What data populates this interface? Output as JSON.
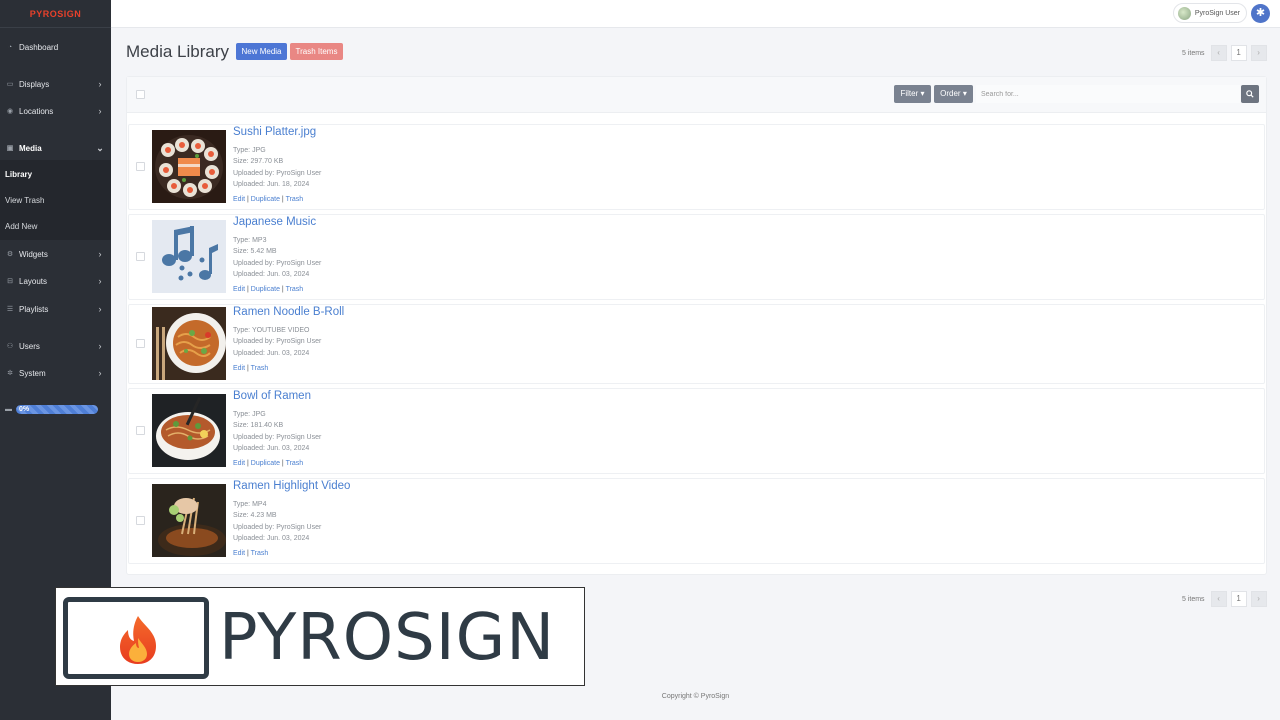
{
  "brand": "PYROSIGN",
  "sidebar": {
    "items": [
      {
        "label": "Dashboard",
        "icon": "dashboard-icon"
      },
      {
        "label": "Displays",
        "icon": "monitor-icon"
      },
      {
        "label": "Locations",
        "icon": "map-pin-icon"
      },
      {
        "label": "Media",
        "icon": "images-icon"
      },
      {
        "label": "Widgets",
        "icon": "widgets-icon"
      },
      {
        "label": "Layouts",
        "icon": "layout-icon"
      },
      {
        "label": "Playlists",
        "icon": "list-icon"
      },
      {
        "label": "Users",
        "icon": "users-icon"
      },
      {
        "label": "System",
        "icon": "gear-icon"
      }
    ],
    "media_sub": [
      "Library",
      "View Trash",
      "Add New"
    ],
    "storage_percent": "0%"
  },
  "topbar": {
    "user_name": "PyroSign User"
  },
  "main": {
    "title": "Media Library",
    "new_button": "New Media",
    "trash_button": "Trash Items",
    "items_count": "5 items",
    "pager": {
      "prev": "‹",
      "page": "1",
      "next": "›"
    }
  },
  "toolbar": {
    "filter": "Filter",
    "order": "Order",
    "search_placeholder": "Search for..."
  },
  "media": [
    {
      "title": "Sushi Platter.jpg",
      "type": "Type: JPG",
      "size": "Size: 297.70 KB",
      "by": "Uploaded by: PyroSign User",
      "date": "Uploaded: Jun. 18, 2024",
      "edit": "Edit",
      "duplicate": "Duplicate",
      "trash": "Trash"
    },
    {
      "title": "Japanese Music",
      "type": "Type: MP3",
      "size": "Size: 5.42 MB",
      "by": "Uploaded by: PyroSign User",
      "date": "Uploaded: Jun. 03, 2024",
      "edit": "Edit",
      "duplicate": "Duplicate",
      "trash": "Trash"
    },
    {
      "title": "Ramen Noodle B-Roll",
      "type": "Type: YOUTUBE VIDEO",
      "by": "Uploaded by: PyroSign User",
      "date": "Uploaded: Jun. 03, 2024",
      "edit": "Edit",
      "trash": "Trash"
    },
    {
      "title": "Bowl of Ramen",
      "type": "Type: JPG",
      "size": "Size: 181.40 KB",
      "by": "Uploaded by: PyroSign User",
      "date": "Uploaded: Jun. 03, 2024",
      "edit": "Edit",
      "duplicate": "Duplicate",
      "trash": "Trash"
    },
    {
      "title": "Ramen Highlight Video",
      "type": "Type: MP4",
      "size": "Size: 4.23 MB",
      "by": "Uploaded by: PyroSign User",
      "date": "Uploaded: Jun. 03, 2024",
      "edit": "Edit",
      "trash": "Trash"
    }
  ],
  "footer": "Copyright © PyroSign",
  "logo_text": "PYROSIGN",
  "colors": {
    "brand": "#e8412b",
    "primary": "#4d76d5",
    "danger": "#e98784",
    "link": "#4a7fd0",
    "sidebar": "#2b2f36"
  }
}
